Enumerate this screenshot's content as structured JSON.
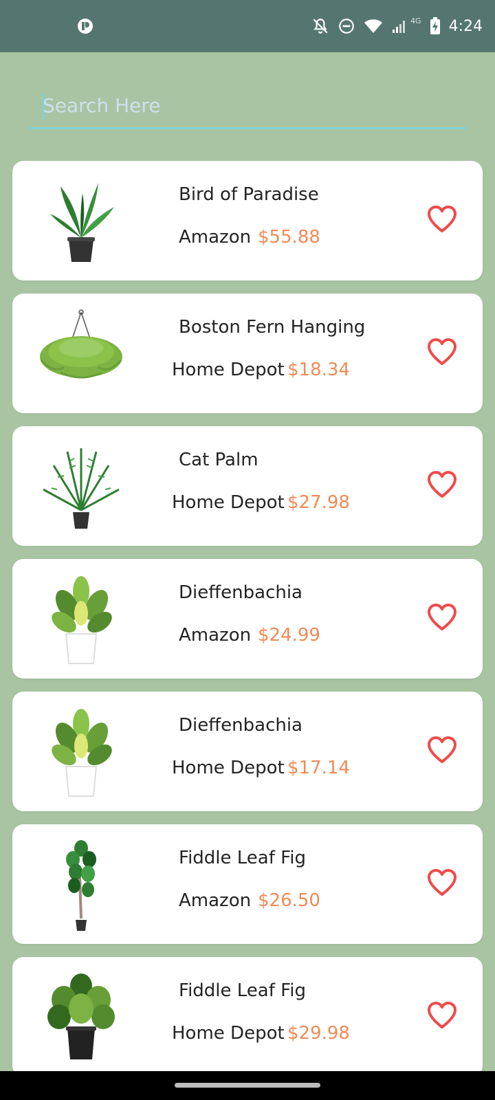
{
  "status_bar": {
    "time": "4:24",
    "network_label": "4G",
    "icons": [
      "app-icon",
      "notifications-off-icon",
      "do-not-disturb-icon",
      "wifi-icon",
      "signal-icon",
      "battery-charging-icon"
    ]
  },
  "search": {
    "placeholder": "Search Here",
    "value": ""
  },
  "colors": {
    "status_bar": "#557570",
    "background": "#a9c4a3",
    "price": "#f28a55",
    "heart": "#f04a4a",
    "search_underline": "#7fd3d7"
  },
  "items": [
    {
      "name": "Bird of Paradise",
      "vendor": "Amazon",
      "price": "$55.88",
      "image": "bird-of-paradise-plant"
    },
    {
      "name": "Boston Fern Hanging",
      "vendor": "Home Depot",
      "price": "$18.34",
      "image": "boston-fern-hanging-plant"
    },
    {
      "name": "Cat Palm",
      "vendor": "Home Depot",
      "price": "$27.98",
      "image": "cat-palm-plant"
    },
    {
      "name": "Dieffenbachia",
      "vendor": "Amazon",
      "price": "$24.99",
      "image": "dieffenbachia-plant"
    },
    {
      "name": "Dieffenbachia",
      "vendor": "Home Depot",
      "price": "$17.14",
      "image": "dieffenbachia-plant"
    },
    {
      "name": "Fiddle Leaf Fig",
      "vendor": "Amazon",
      "price": "$26.50",
      "image": "fiddle-leaf-fig-tree"
    },
    {
      "name": "Fiddle Leaf Fig",
      "vendor": "Home Depot",
      "price": "$29.98",
      "image": "fiddle-leaf-fig-bush"
    }
  ]
}
